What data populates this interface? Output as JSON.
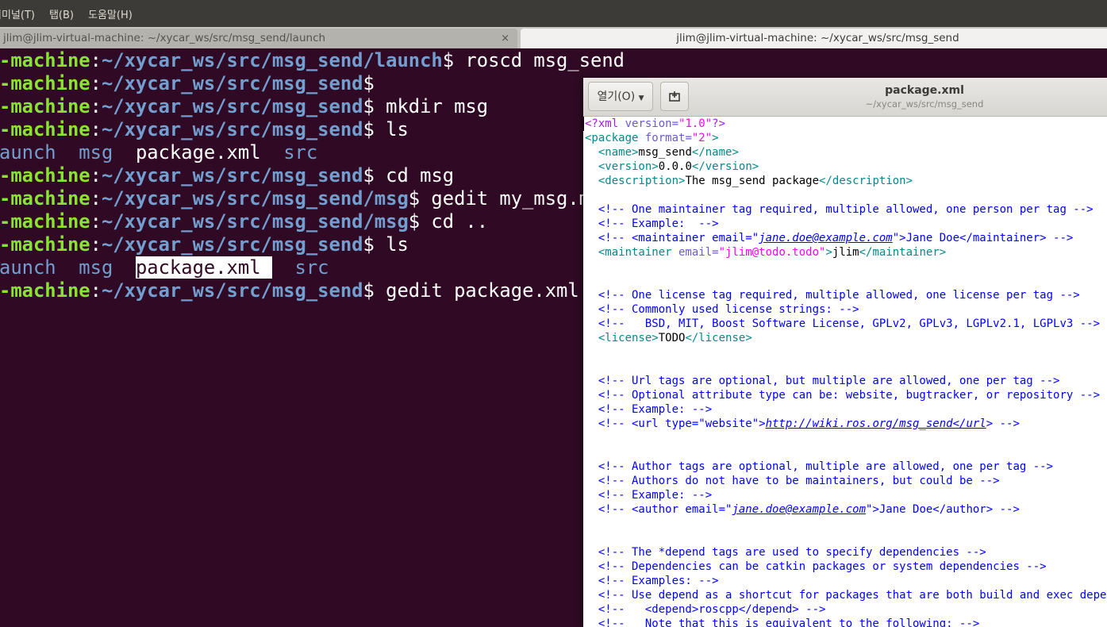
{
  "menubar": {
    "items": [
      "터미널(T)",
      "탭(B)",
      "도움말(H)"
    ]
  },
  "tabs": [
    {
      "title": "jlim@jlim-virtual-machine: ~/xycar_ws/src/msg_send/launch",
      "close": "×"
    },
    {
      "title": "jlim@jlim-virtual-machine: ~/xycar_ws/src/msg_send"
    }
  ],
  "terminal": {
    "prompt_user": "-machine",
    "lines": [
      {
        "path": "~/xycar_ws/src/msg_send/launch",
        "cmd": " roscd msg_send"
      },
      {
        "path": "~/xycar_ws/src/msg_send",
        "cmd": ""
      },
      {
        "path": "~/xycar_ws/src/msg_send",
        "cmd": " mkdir msg"
      },
      {
        "path": "~/xycar_ws/src/msg_send",
        "cmd": " ls"
      },
      {
        "ls": [
          "aunch",
          "msg",
          "package.xml",
          "src"
        ]
      },
      {
        "path": "~/xycar_ws/src/msg_send",
        "cmd": " cd msg"
      },
      {
        "path": "~/xycar_ws/src/msg_send/msg",
        "cmd": " gedit my_msg.msg"
      },
      {
        "path": "~/xycar_ws/src/msg_send/msg",
        "cmd": " cd .."
      },
      {
        "path": "~/xycar_ws/src/msg_send",
        "cmd": " ls"
      },
      {
        "ls": [
          "aunch",
          "msg",
          "package.xml",
          "src"
        ],
        "highlight": "package.xml"
      },
      {
        "path": "~/xycar_ws/src/msg_send",
        "cmd": " gedit package.xml"
      }
    ]
  },
  "gedit": {
    "open_label": "열기(O)",
    "title": "package.xml",
    "subtitle": "~/xycar_ws/src/msg_send",
    "lines": [
      "<?xml version=\"1.0\"?>",
      "<package format=\"2\">",
      "  <name>msg_send</name>",
      "  <version>0.0.0</version>",
      "  <description>The msg_send package</description>",
      "",
      "  <!-- One maintainer tag required, multiple allowed, one person per tag -->",
      "  <!-- Example:  -->",
      "  <!-- <maintainer email=\"jane.doe@example.com\">Jane Doe</maintainer> -->",
      "  <maintainer email=\"jlim@todo.todo\">jlim</maintainer>",
      "",
      "",
      "  <!-- One license tag required, multiple allowed, one license per tag -->",
      "  <!-- Commonly used license strings: -->",
      "  <!--   BSD, MIT, Boost Software License, GPLv2, GPLv3, LGPLv2.1, LGPLv3 -->",
      "  <license>TODO</license>",
      "",
      "",
      "  <!-- Url tags are optional, but multiple are allowed, one per tag -->",
      "  <!-- Optional attribute type can be: website, bugtracker, or repository -->",
      "  <!-- Example: -->",
      "  <!-- <url type=\"website\">http://wiki.ros.org/msg_send</url> -->",
      "",
      "",
      "  <!-- Author tags are optional, multiple are allowed, one per tag -->",
      "  <!-- Authors do not have to be maintainers, but could be -->",
      "  <!-- Example: -->",
      "  <!-- <author email=\"jane.doe@example.com\">Jane Doe</author> -->",
      "",
      "",
      "  <!-- The *depend tags are used to specify dependencies -->",
      "  <!-- Dependencies can be catkin packages or system dependencies -->",
      "  <!-- Examples: -->",
      "  <!-- Use depend as a shortcut for packages that are both build and exec dependencies -->",
      "  <!--   <depend>roscpp</depend> -->",
      "  <!--   Note that this is equivalent to the following: -->"
    ]
  }
}
